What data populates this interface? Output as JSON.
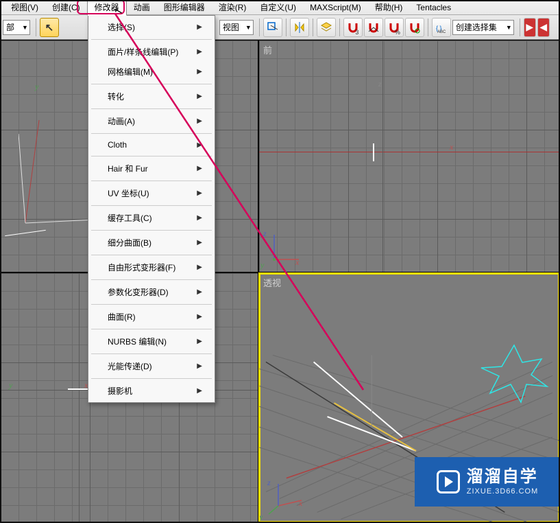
{
  "menubar": {
    "items": [
      {
        "label": "视图(V)"
      },
      {
        "label": "创建(C)"
      },
      {
        "label": "修改器"
      },
      {
        "label": "动画"
      },
      {
        "label": "图形编辑器"
      },
      {
        "label": "渲染(R)"
      },
      {
        "label": "自定义(U)"
      },
      {
        "label": "MAXScript(M)"
      },
      {
        "label": "帮助(H)"
      },
      {
        "label": "Tentacles"
      }
    ],
    "active_index": 2
  },
  "dropdown": {
    "items": [
      {
        "label": "选择(S)",
        "submenu": true,
        "sep_after": true
      },
      {
        "label": "面片/样条线编辑(P)",
        "submenu": true
      },
      {
        "label": "网格编辑(M)",
        "submenu": true,
        "sep_after": true
      },
      {
        "label": "转化",
        "submenu": true,
        "sep_after": true
      },
      {
        "label": "动画(A)",
        "submenu": true,
        "sep_after": true
      },
      {
        "label": "Cloth",
        "submenu": true,
        "sep_after": true
      },
      {
        "label": "Hair 和 Fur",
        "submenu": true,
        "sep_after": true
      },
      {
        "label": "UV 坐标(U)",
        "submenu": true,
        "sep_after": true
      },
      {
        "label": "缓存工具(C)",
        "submenu": true,
        "sep_after": true
      },
      {
        "label": "细分曲面(B)",
        "submenu": true,
        "sep_after": true
      },
      {
        "label": "自由形式变形器(F)",
        "submenu": true,
        "sep_after": true
      },
      {
        "label": "参数化变形器(D)",
        "submenu": true,
        "sep_after": true
      },
      {
        "label": "曲面(R)",
        "submenu": true,
        "sep_after": true
      },
      {
        "label": "NURBS 编辑(N)",
        "submenu": true,
        "sep_after": true
      },
      {
        "label": "光能传递(D)",
        "submenu": true,
        "sep_after": true
      },
      {
        "label": "摄影机",
        "submenu": true
      }
    ]
  },
  "toolbar": {
    "scope_dd": "部",
    "view_dd": "视图",
    "selset_placeholder": "创建选择集"
  },
  "viewports": {
    "top_left": {
      "label": "",
      "ax1": "y",
      "ax2": "x"
    },
    "top_right": {
      "label": "前",
      "ax1": "z",
      "ax2": "x"
    },
    "bottom_left": {
      "label": "",
      "ax1": "y",
      "ax2": "x"
    },
    "bottom_right": {
      "label": "透视"
    }
  },
  "gizmo": {
    "x": "x",
    "y": "y",
    "z": "z"
  },
  "watermark": {
    "main": "溜溜自学",
    "sub": "ZIXUE.3D66.COM"
  }
}
